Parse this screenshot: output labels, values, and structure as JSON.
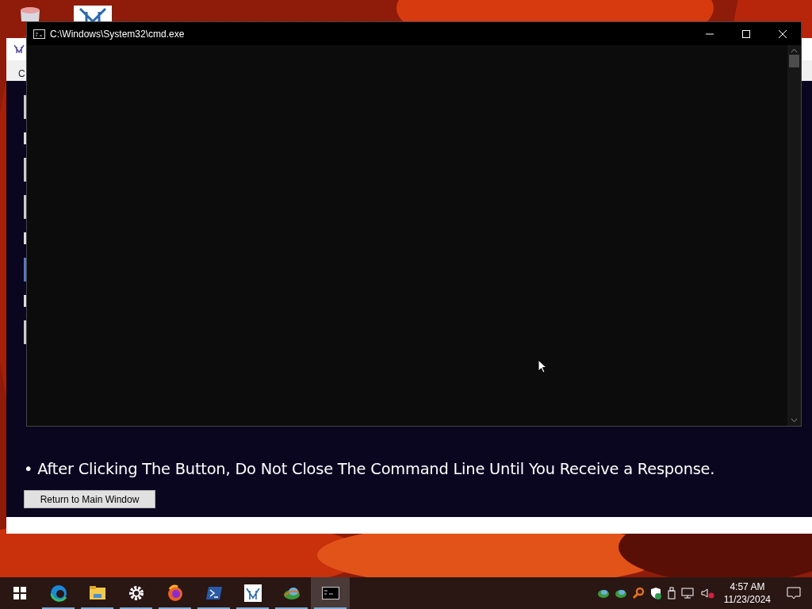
{
  "desktop": {
    "icons": [
      {
        "kind": "bin"
      },
      {
        "kind": "app"
      }
    ]
  },
  "back_window": {
    "menu": [
      "C"
    ],
    "fields": [
      {
        "kind": "field"
      },
      {
        "kind": "label"
      },
      {
        "kind": "field"
      },
      {
        "kind": "field"
      },
      {
        "kind": "label"
      },
      {
        "kind": "focused"
      },
      {
        "kind": "label"
      },
      {
        "kind": "field"
      }
    ],
    "notice": "• After Clicking The Button, Do Not Close The Command Line Until You Receive a Response.",
    "button": "Return to Main Window"
  },
  "console": {
    "title": "C:\\Windows\\System32\\cmd.exe"
  },
  "taskbar": {
    "apps": [
      {
        "kind": "edge",
        "running": true,
        "selected": false
      },
      {
        "kind": "folder",
        "running": true,
        "selected": false
      },
      {
        "kind": "gear",
        "running": true,
        "selected": false
      },
      {
        "kind": "firefox",
        "running": true,
        "selected": false
      },
      {
        "kind": "shell",
        "running": true,
        "selected": false
      },
      {
        "kind": "app",
        "running": true,
        "selected": false
      },
      {
        "kind": "globe",
        "running": true,
        "selected": false
      },
      {
        "kind": "console",
        "running": true,
        "selected": true
      }
    ],
    "clock": {
      "time": "4:57 AM",
      "date": "11/23/2024"
    }
  }
}
